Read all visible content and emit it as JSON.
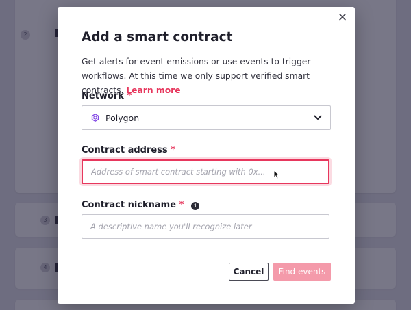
{
  "background": {
    "steps": [
      "2",
      "3",
      "4"
    ]
  },
  "modal": {
    "title": "Add a smart contract",
    "description": "Get alerts for event emissions or use events to trigger workflows. At this time we only support verified smart contracts.",
    "learn_more": "Learn more",
    "close_icon": "close-icon"
  },
  "network": {
    "label": "Network",
    "required": "*",
    "selected": "Polygon",
    "icon": "polygon-logo-icon"
  },
  "contract_address": {
    "label": "Contract address",
    "required": "*",
    "placeholder": "Address of smart contract starting with 0x...",
    "value": ""
  },
  "contract_nickname": {
    "label": "Contract nickname",
    "required": "*",
    "info_icon": "i",
    "placeholder": "A descriptive name you'll recognize later",
    "value": ""
  },
  "buttons": {
    "cancel": "Cancel",
    "find_events": "Find events"
  },
  "colors": {
    "accent": "#e7375d",
    "primary_disabled": "#f49aaa",
    "overlay": "#3a3850",
    "polygon_purple": "#8247e5"
  }
}
